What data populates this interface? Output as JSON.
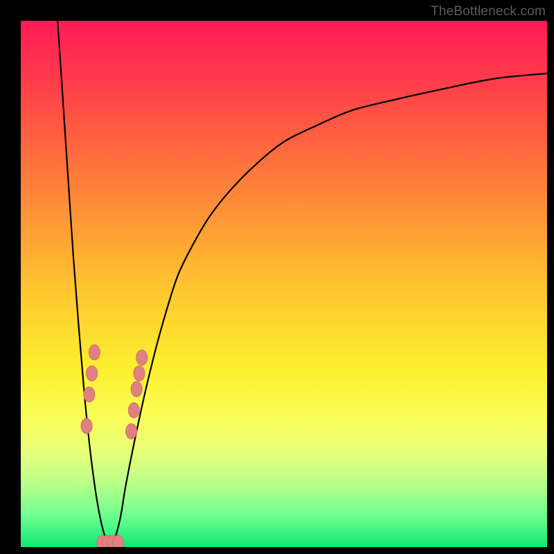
{
  "watermark": "TheBottleneck.com",
  "domain_note": "Bottleneck curve chart",
  "chart_data": {
    "type": "line",
    "title": "",
    "xlabel": "",
    "ylabel": "",
    "xlim": [
      0,
      100
    ],
    "ylim": [
      0,
      100
    ],
    "series": [
      {
        "name": "bottleneck-curve",
        "x": [
          7,
          8,
          9,
          10,
          11,
          12,
          13,
          14,
          15,
          16,
          17,
          18,
          19,
          20,
          22,
          24,
          26,
          28,
          30,
          33,
          36,
          40,
          45,
          50,
          56,
          63,
          71,
          80,
          90,
          100
        ],
        "y": [
          100,
          85,
          70,
          55,
          42,
          30,
          20,
          12,
          6,
          2,
          0,
          2,
          6,
          12,
          22,
          31,
          39,
          46,
          52,
          58,
          63,
          68,
          73,
          77,
          80,
          83,
          85,
          87,
          89,
          90
        ]
      }
    ],
    "markers": [
      {
        "x": 12.5,
        "y": 23
      },
      {
        "x": 13.0,
        "y": 29
      },
      {
        "x": 13.5,
        "y": 33
      },
      {
        "x": 14.0,
        "y": 37
      },
      {
        "x": 15.5,
        "y": 0.8
      },
      {
        "x": 16.5,
        "y": 0.8
      },
      {
        "x": 17.5,
        "y": 0.8
      },
      {
        "x": 18.5,
        "y": 0.8
      },
      {
        "x": 21.0,
        "y": 22
      },
      {
        "x": 21.5,
        "y": 26
      },
      {
        "x": 22.0,
        "y": 30
      },
      {
        "x": 22.5,
        "y": 33
      },
      {
        "x": 23.0,
        "y": 36
      }
    ],
    "gradient_stops": [
      {
        "pos": 0,
        "color": "#ff1a56"
      },
      {
        "pos": 25,
        "color": "#ff6a3e"
      },
      {
        "pos": 52,
        "color": "#ffc92f"
      },
      {
        "pos": 76,
        "color": "#f7ff5a"
      },
      {
        "pos": 94,
        "color": "#6fff8f"
      },
      {
        "pos": 100,
        "color": "#10e874"
      }
    ]
  }
}
